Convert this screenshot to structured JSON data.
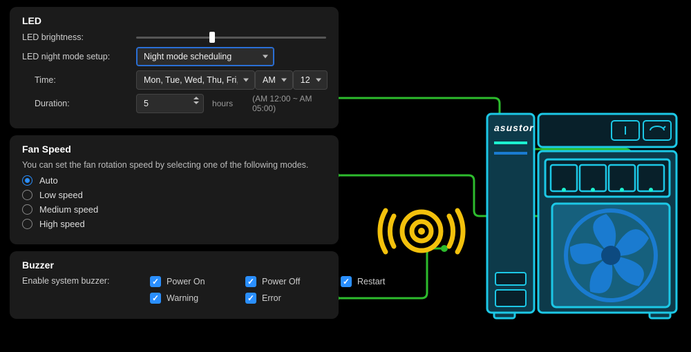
{
  "led": {
    "title": "LED",
    "brightness_label": "LED brightness:",
    "brightness_pct": 40,
    "night_mode_label": "LED night mode setup:",
    "night_mode_value": "Night mode scheduling",
    "time_label": "Time:",
    "days_value": "Mon, Tue, Wed, Thu, Fri, Sat, Sun",
    "ampm_value": "AM",
    "hour_value": "12",
    "duration_label": "Duration:",
    "duration_value": "5",
    "duration_unit": "hours",
    "duration_hint": "(AM 12:00 ~ AM 05:00)"
  },
  "fan": {
    "title": "Fan Speed",
    "desc": "You can set the fan rotation speed by selecting one of the following modes.",
    "options": [
      {
        "label": "Auto",
        "checked": true
      },
      {
        "label": "Low speed",
        "checked": false
      },
      {
        "label": "Medium speed",
        "checked": false
      },
      {
        "label": "High speed",
        "checked": false
      }
    ]
  },
  "buzzer": {
    "title": "Buzzer",
    "enable_label": "Enable system buzzer:",
    "row1": [
      {
        "label": "Power On"
      },
      {
        "label": "Power Off"
      },
      {
        "label": "Restart"
      }
    ],
    "row2": [
      {
        "label": "Warning"
      },
      {
        "label": "Error"
      }
    ]
  },
  "device": {
    "brand": "asustor"
  }
}
